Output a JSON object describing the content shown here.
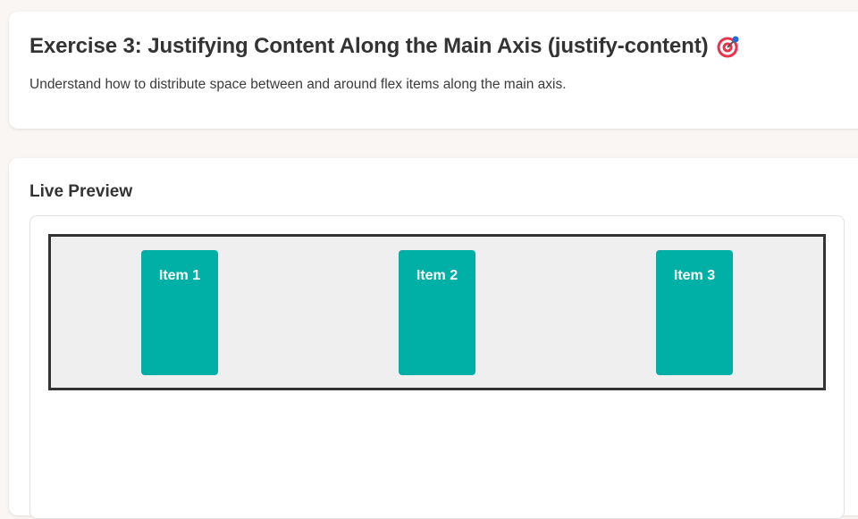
{
  "header": {
    "title": "Exercise 3: Justifying Content Along the Main Axis (justify-content)",
    "title_icon": "target-icon",
    "subtitle": "Understand how to distribute space between and around flex items along the main axis."
  },
  "preview": {
    "section_title": "Live Preview",
    "items": [
      {
        "label": "Item 1"
      },
      {
        "label": "Item 2"
      },
      {
        "label": "Item 3"
      }
    ]
  },
  "colors": {
    "page_background": "#f9f6f3",
    "item_color": "#00afa6",
    "container_background": "#efefef",
    "container_border": "#333333"
  }
}
